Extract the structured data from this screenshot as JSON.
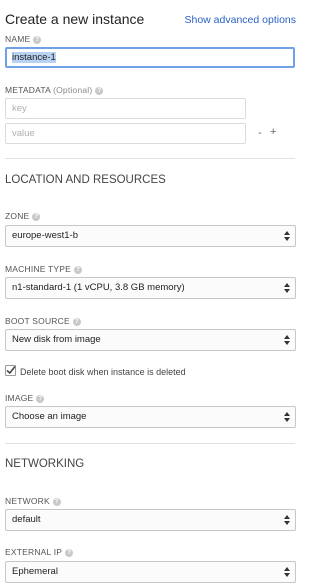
{
  "header": {
    "title": "Create a new instance",
    "advanced_link": "Show advanced options"
  },
  "name": {
    "label": "NAME",
    "value": "instance-1"
  },
  "metadata": {
    "label": "METADATA",
    "optional": "(Optional)",
    "key_placeholder": "key",
    "value_placeholder": "value",
    "remove": "-",
    "add": "+"
  },
  "location": {
    "heading": "LOCATION AND RESOURCES",
    "zone": {
      "label": "ZONE",
      "value": "europe-west1-b"
    },
    "machine_type": {
      "label": "MACHINE TYPE",
      "value": "n1-standard-1 (1 vCPU, 3.8 GB memory)"
    },
    "boot_source": {
      "label": "BOOT SOURCE",
      "value": "New disk from image"
    },
    "delete_disk": {
      "label": "Delete boot disk when instance is deleted",
      "checked": true
    },
    "image": {
      "label": "IMAGE",
      "value": "Choose an image"
    }
  },
  "networking": {
    "heading": "NETWORKING",
    "network": {
      "label": "NETWORK",
      "value": "default"
    },
    "external_ip": {
      "label": "EXTERNAL IP",
      "value": "Ephemeral"
    }
  },
  "colors": {
    "link": "#2b62c4",
    "focus_border": "#6ea2e6",
    "selection": "#b8d2f3"
  }
}
